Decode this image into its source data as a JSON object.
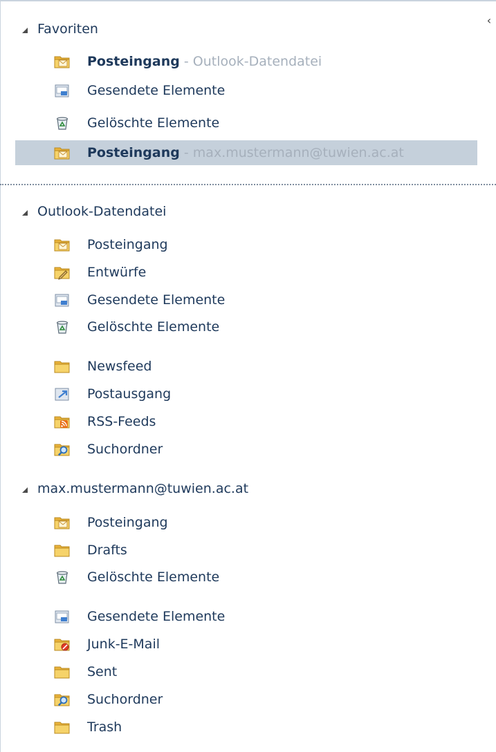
{
  "pane": {
    "collapse_glyph": "‹"
  },
  "favorites": {
    "header": "Favoriten",
    "items": [
      {
        "icon": "inbox-folder-icon",
        "label": "Posteingang",
        "sub": " - Outlook-Datendatei"
      },
      {
        "icon": "sent-items-folder-icon",
        "label": "Gesendete Elemente",
        "sub": ""
      },
      {
        "icon": "deleted-items-icon",
        "label": "Gelöschte Elemente",
        "sub": ""
      },
      {
        "icon": "inbox-folder-icon",
        "label": "Posteingang",
        "sub": " - max.mustermann@tuwien.ac.at",
        "selected": true
      }
    ]
  },
  "outlook_datafile": {
    "header": "Outlook-Datendatei",
    "items": [
      {
        "icon": "inbox-folder-icon",
        "label": "Posteingang"
      },
      {
        "icon": "drafts-folder-icon",
        "label": "Entwürfe"
      },
      {
        "icon": "sent-items-folder-icon",
        "label": "Gesendete Elemente"
      },
      {
        "icon": "deleted-items-icon",
        "label": "Gelöschte Elemente"
      },
      {
        "icon": "folder-icon",
        "label": "Newsfeed"
      },
      {
        "icon": "outbox-folder-icon",
        "label": "Postausgang"
      },
      {
        "icon": "rss-feeds-folder-icon",
        "label": "RSS-Feeds"
      },
      {
        "icon": "search-folder-icon",
        "label": "Suchordner"
      }
    ]
  },
  "account": {
    "header": "max.mustermann@tuwien.ac.at",
    "items": [
      {
        "icon": "inbox-folder-icon",
        "label": "Posteingang"
      },
      {
        "icon": "folder-icon",
        "label": "Drafts"
      },
      {
        "icon": "deleted-items-icon",
        "label": "Gelöschte Elemente"
      },
      {
        "icon": "sent-items-folder-icon",
        "label": "Gesendete Elemente"
      },
      {
        "icon": "junk-mail-folder-icon",
        "label": "Junk-E-Mail"
      },
      {
        "icon": "folder-icon",
        "label": "Sent"
      },
      {
        "icon": "search-folder-icon",
        "label": "Suchordner"
      },
      {
        "icon": "folder-icon",
        "label": "Trash"
      }
    ]
  },
  "colors": {
    "text": "#1e395b",
    "sub_text": "#a6b0bc",
    "selection": "#c5d0db",
    "folder": "#f2c24a"
  }
}
